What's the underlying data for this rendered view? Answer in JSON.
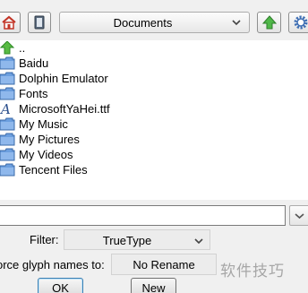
{
  "toolbar": {
    "home_icon": "home-icon",
    "bookmark_icon": "bookmark-icon",
    "location": "Documents",
    "up_icon": "up-arrow-icon",
    "settings_icon": "gear-icon"
  },
  "files": [
    {
      "name": "..",
      "icon": "up-arrow-icon"
    },
    {
      "name": "Baidu",
      "icon": "folder-icon"
    },
    {
      "name": "Dolphin Emulator",
      "icon": "folder-icon"
    },
    {
      "name": "Fonts",
      "icon": "folder-icon"
    },
    {
      "name": "MicrosoftYaHei.ttf",
      "icon": "font-file-icon"
    },
    {
      "name": "My Music",
      "icon": "folder-icon"
    },
    {
      "name": "My Pictures",
      "icon": "folder-icon"
    },
    {
      "name": "My Videos",
      "icon": "folder-icon"
    },
    {
      "name": "Tencent Files",
      "icon": "folder-icon"
    }
  ],
  "path_field": {
    "value": ""
  },
  "filter": {
    "label": "Filter:",
    "value": "TrueType"
  },
  "glyph_names": {
    "label": "orce glyph names to:",
    "value": "No Rename"
  },
  "buttons": {
    "ok": "OK",
    "new": "New"
  },
  "watermark": "软件技巧",
  "colors": {
    "folder": "#5b8fd6",
    "up_arrow": "#3aa53a",
    "home": "#d23b2b"
  }
}
